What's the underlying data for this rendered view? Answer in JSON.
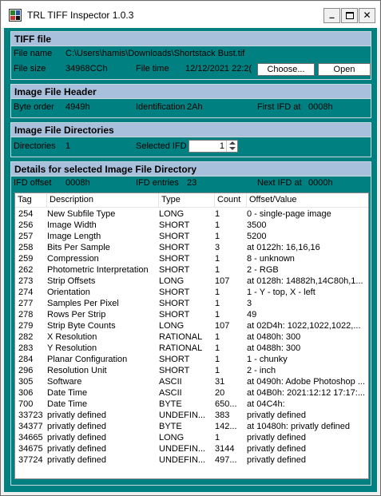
{
  "window": {
    "title": "TRL TIFF Inspector 1.0.3",
    "minimize_glyph": "_",
    "close_glyph": "✕"
  },
  "tiff_file": {
    "header": "TIFF file",
    "file_name_label": "File name",
    "file_name": "C:\\Users\\hamis\\Downloads\\Shortstack Bust.tif",
    "file_size_label": "File size",
    "file_size": "34968CCh",
    "file_time_label": "File time",
    "file_time": "12/12/2021 22:2(",
    "choose_label": "Choose...",
    "open_label": "Open"
  },
  "image_file_header": {
    "header": "Image File Header",
    "byte_order_label": "Byte order",
    "byte_order": "4949h",
    "identification_label": "Identification",
    "identification": "2Ah",
    "first_ifd_label": "First IFD at",
    "first_ifd": "0008h"
  },
  "image_file_directories": {
    "header": "Image File Directories",
    "directories_label": "Directories",
    "directories": "1",
    "selected_ifd_label": "Selected IFD",
    "selected_ifd": "1"
  },
  "details": {
    "header": "Details for selected Image File Directory",
    "ifd_offset_label": "IFD offset",
    "ifd_offset": "0008h",
    "ifd_entries_label": "IFD entries",
    "ifd_entries": "23",
    "next_ifd_label": "Next IFD at",
    "next_ifd": "0000h",
    "columns": [
      "Tag",
      "Description",
      "Type",
      "Count",
      "Offset/Value"
    ],
    "rows": [
      [
        "254",
        "New Subfile Type",
        "LONG",
        "1",
        "0 - single-page image"
      ],
      [
        "256",
        "Image Width",
        "SHORT",
        "1",
        "3500"
      ],
      [
        "257",
        "Image Length",
        "SHORT",
        "1",
        "5200"
      ],
      [
        "258",
        "Bits Per Sample",
        "SHORT",
        "3",
        "at 0122h: 16,16,16"
      ],
      [
        "259",
        "Compression",
        "SHORT",
        "1",
        "8 - unknown"
      ],
      [
        "262",
        "Photometric Interpretation",
        "SHORT",
        "1",
        "2 - RGB"
      ],
      [
        "273",
        "Strip Offsets",
        "LONG",
        "107",
        "at 0128h: 14882h,14C80h,1..."
      ],
      [
        "274",
        "Orientation",
        "SHORT",
        "1",
        "1 - Y - top, X - left"
      ],
      [
        "277",
        "Samples Per Pixel",
        "SHORT",
        "1",
        "3"
      ],
      [
        "278",
        "Rows Per Strip",
        "SHORT",
        "1",
        "49"
      ],
      [
        "279",
        "Strip Byte Counts",
        "LONG",
        "107",
        "at 02D4h: 1022,1022,1022,..."
      ],
      [
        "282",
        "X Resolution",
        "RATIONAL",
        "1",
        "at 0480h: 300"
      ],
      [
        "283",
        "Y Resolution",
        "RATIONAL",
        "1",
        "at 0488h: 300"
      ],
      [
        "284",
        "Planar Configuration",
        "SHORT",
        "1",
        "1 - chunky"
      ],
      [
        "296",
        "Resolution Unit",
        "SHORT",
        "1",
        "2 - inch"
      ],
      [
        "305",
        "Software",
        "ASCII",
        "31",
        "at 0490h: Adobe Photoshop ..."
      ],
      [
        "306",
        "Date Time",
        "ASCII",
        "20",
        "at 04B0h: 2021:12:12 17:17:..."
      ],
      [
        "700",
        "Date Time",
        "BYTE",
        "650...",
        "at 04C4h:"
      ],
      [
        "33723",
        "privatly defined",
        "UNDEFIN...",
        "383",
        "privatly defined"
      ],
      [
        "34377",
        "privatly defined",
        "BYTE",
        "142...",
        "at 10480h: privatly defined"
      ],
      [
        "34665",
        "privatly defined",
        "LONG",
        "1",
        "privatly defined"
      ],
      [
        "34675",
        "privatly defined",
        "UNDEFIN...",
        "3144",
        "privatly defined"
      ],
      [
        "37724",
        "privatly defined",
        "UNDEFIN...",
        "497...",
        "privatly defined"
      ]
    ]
  }
}
